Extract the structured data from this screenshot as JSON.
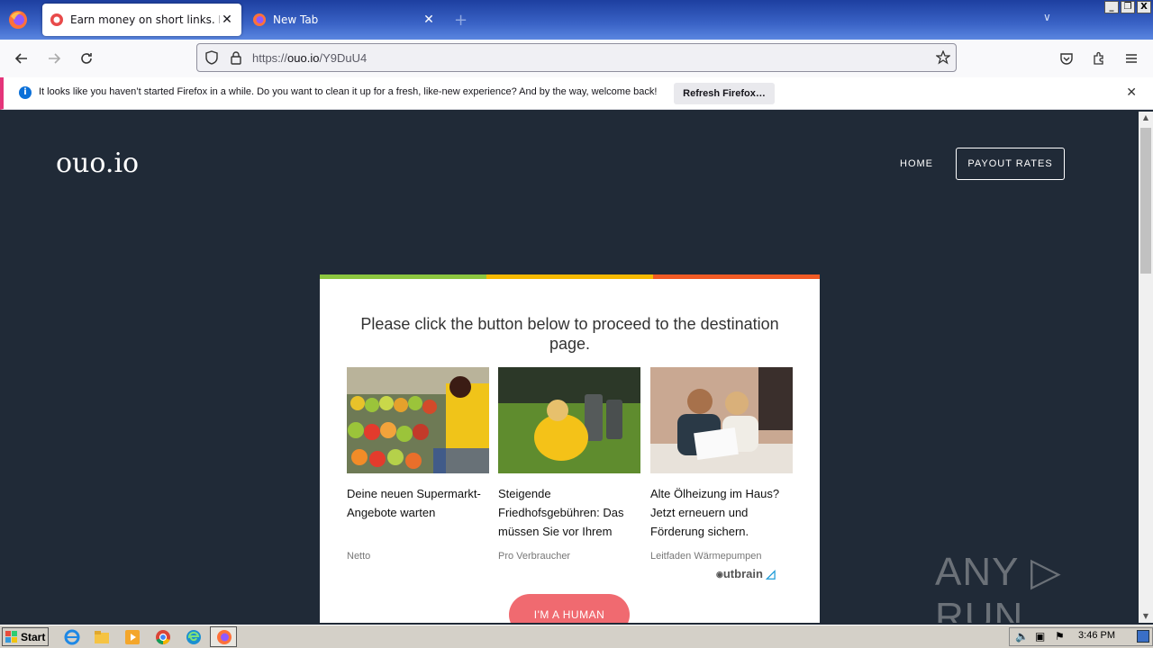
{
  "browser": {
    "tabs": [
      {
        "title": "Earn money on short links. Make sh",
        "active": true
      },
      {
        "title": "New Tab",
        "active": false
      }
    ],
    "url": {
      "prefix": "https://",
      "host": "ouo.io",
      "path": "/Y9DuU4"
    },
    "window_controls": [
      "_",
      "❐",
      "X"
    ]
  },
  "notification": {
    "text": "It looks like you haven’t started Firefox in a while. Do you want to clean it up for a fresh, like-new experience? And by the way, welcome back!",
    "button": "Refresh Firefox…"
  },
  "site": {
    "logo": "ouo.io",
    "nav": {
      "home": "HOME",
      "payout": "PAYOUT RATES"
    },
    "heading": "Please click the button below to proceed to the destination page.",
    "ads": [
      {
        "headline": "Deine neuen Supermarkt-Angebote warten",
        "source": "Netto"
      },
      {
        "headline": "Steigende Friedhofsgebühren: Das müssen Sie vor Ihrem",
        "source": "Pro Verbraucher"
      },
      {
        "headline": "Alte Ölheizung im Haus? Jetzt erneuern und Förderung sichern.",
        "source": "Leitfaden Wärmepumpen"
      }
    ],
    "ad_network": "Outbrain",
    "human_button": "I'M A HUMAN",
    "accent_colors": [
      "#8cc63f",
      "#f6b900",
      "#f15a24"
    ]
  },
  "watermark": "ANY ▷ RUN",
  "taskbar": {
    "start": "Start",
    "time": "3:46 PM"
  }
}
